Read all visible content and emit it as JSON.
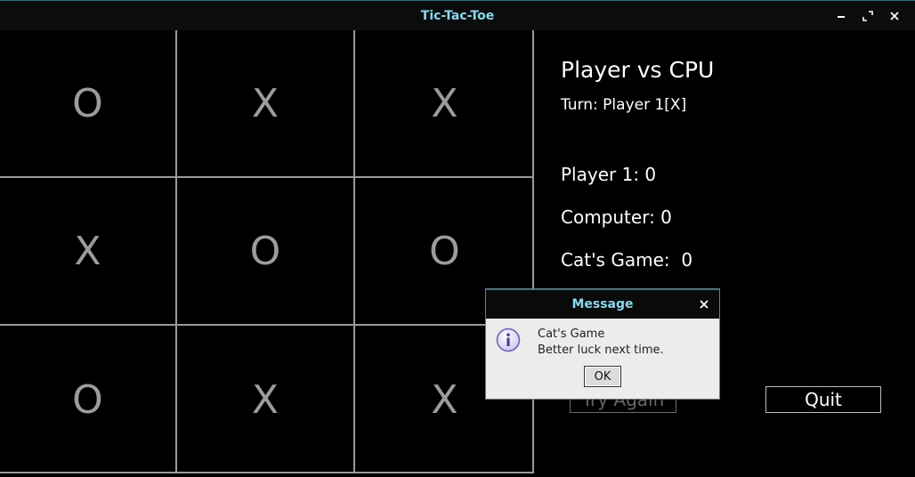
{
  "window": {
    "title": "Tic-Tac-Toe",
    "controls": [
      "minimize-icon",
      "maximize-icon",
      "close-icon"
    ]
  },
  "board": {
    "cells": [
      [
        "O",
        "X",
        "X"
      ],
      [
        "X",
        "O",
        "O"
      ],
      [
        "O",
        "X",
        "X"
      ]
    ]
  },
  "panel": {
    "heading": "Player vs CPU",
    "turn": "Turn: Player 1[X]",
    "player1": "Player 1: 0",
    "computer": "Computer: 0",
    "cats_game": "Cat's Game:  0",
    "try_again_label": "Try Again",
    "quit_label": "Quit"
  },
  "dialog": {
    "title": "Message",
    "line1": "Cat's Game",
    "line2": "Better luck next time.",
    "ok_label": "OK",
    "icon": "info-icon"
  },
  "colors": {
    "title_text": "#8ad8ee",
    "grid_line": "#9a9a9a",
    "mark": "#9c9c9c",
    "info_icon": "#6a5fb0"
  }
}
